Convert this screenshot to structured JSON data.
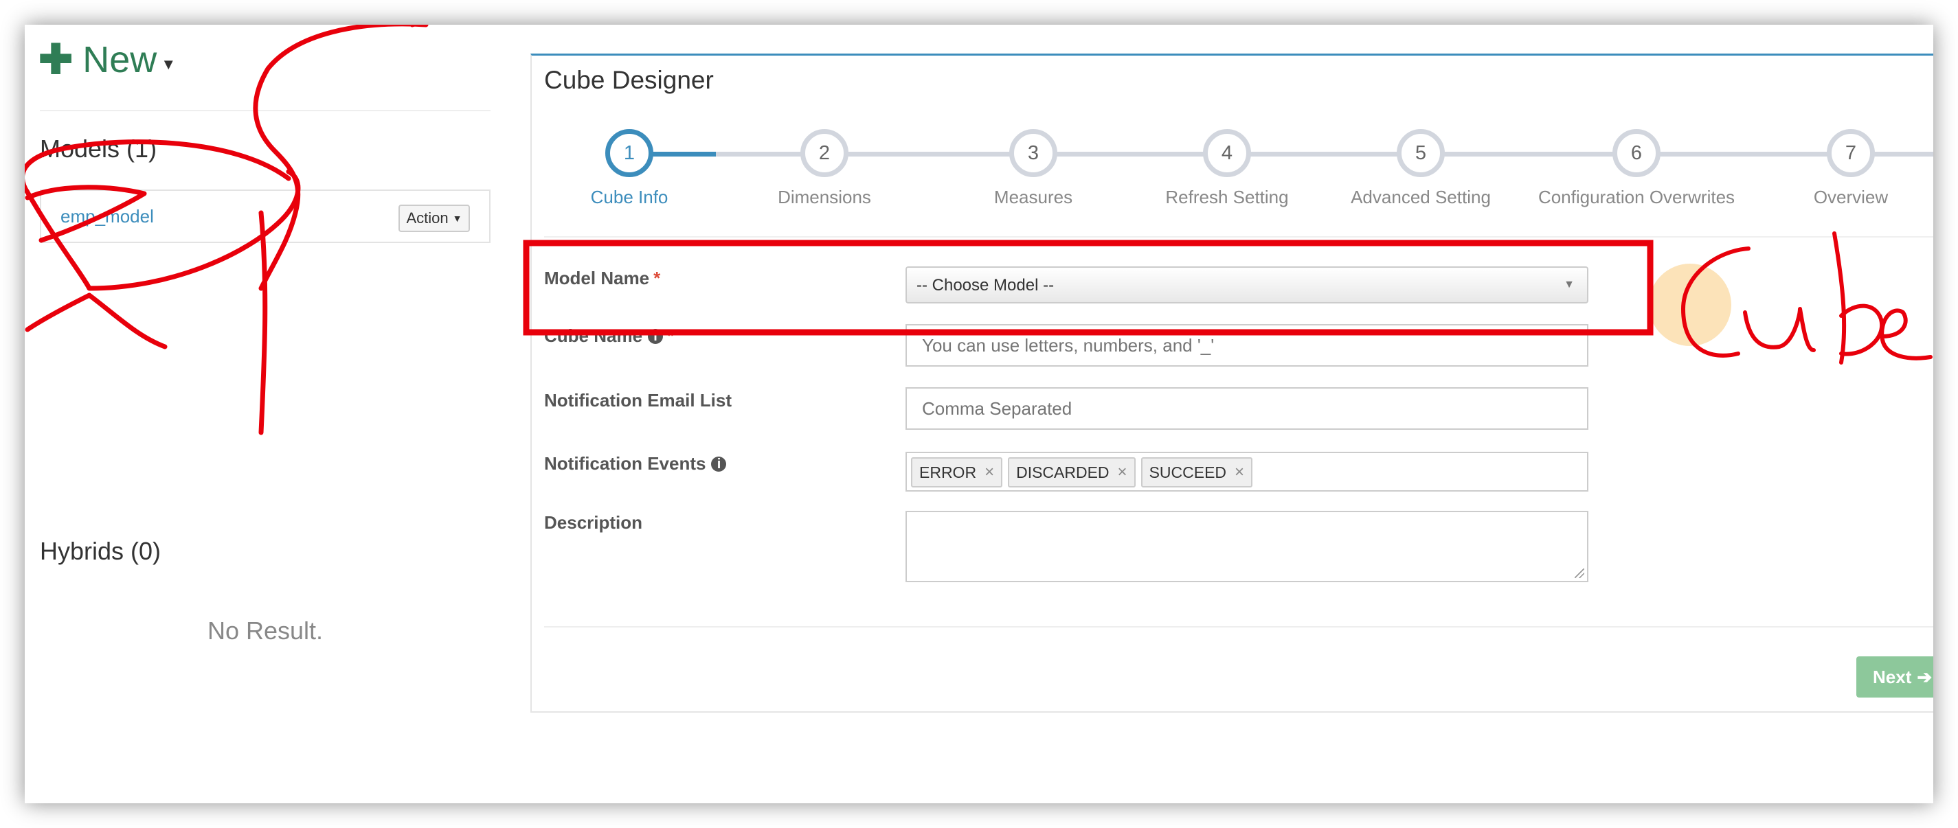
{
  "sidebar": {
    "new_label": "New",
    "models_heading": "Models (1)",
    "models": [
      {
        "name": "emp_model",
        "action_label": "Action"
      }
    ],
    "hybrids_heading": "Hybrids (0)",
    "no_result": "No Result."
  },
  "designer": {
    "title": "Cube Designer",
    "steps": [
      {
        "number": "1",
        "label": "Cube Info",
        "active": true
      },
      {
        "number": "2",
        "label": "Dimensions"
      },
      {
        "number": "3",
        "label": "Measures"
      },
      {
        "number": "4",
        "label": "Refresh Setting"
      },
      {
        "number": "5",
        "label": "Advanced Setting"
      },
      {
        "number": "6",
        "label": "Configuration Overwrites"
      },
      {
        "number": "7",
        "label": "Overview"
      }
    ],
    "form": {
      "model_name_label": "Model Name",
      "required_mark": "*",
      "model_select_value": "-- Choose Model --",
      "cube_name_label": "Cube Name",
      "cube_name_placeholder": "You can use letters, numbers, and '_'",
      "email_label": "Notification Email List",
      "email_placeholder": "Comma Separated",
      "events_label": "Notification Events",
      "events": [
        "ERROR",
        "DISCARDED",
        "SUCCEED"
      ],
      "description_label": "Description"
    },
    "next_label": "Next"
  },
  "annotation": {
    "handwritten_text": "Cube",
    "color": "#e8000b"
  },
  "colors": {
    "accent": "#3c8dbc",
    "new_green": "#2f7d55",
    "required_red": "#dd4b39",
    "next_button": "#8dc89b"
  }
}
